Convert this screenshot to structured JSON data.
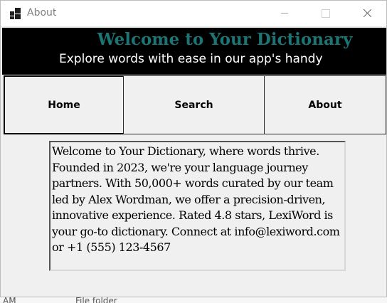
{
  "window": {
    "title": "About",
    "icon": "app-window-icon",
    "controls": [
      "minimize-icon",
      "maximize-icon",
      "close-icon"
    ]
  },
  "banner": {
    "title": "Welcome to Your Dictionary",
    "subtitle": "Explore words with ease in our app's handy",
    "title_color": "#1c7474",
    "background": "#000000"
  },
  "nav": {
    "home": "Home",
    "search": "Search",
    "about": "About"
  },
  "about": {
    "text": "Welcome to Your Dictionary, where words thrive. Founded in 2023, we're your language journey partners. With 50,000+ words curated by our team led by Alex Wordman, we offer a precision-driven, innovative experience. Rated 4.8 stars, LexiWord is your go-to dictionary. Connect at info@lexiword.com or +1 (555) 123-4567"
  },
  "background_strip": {
    "left": "AM",
    "right": "File folder"
  }
}
